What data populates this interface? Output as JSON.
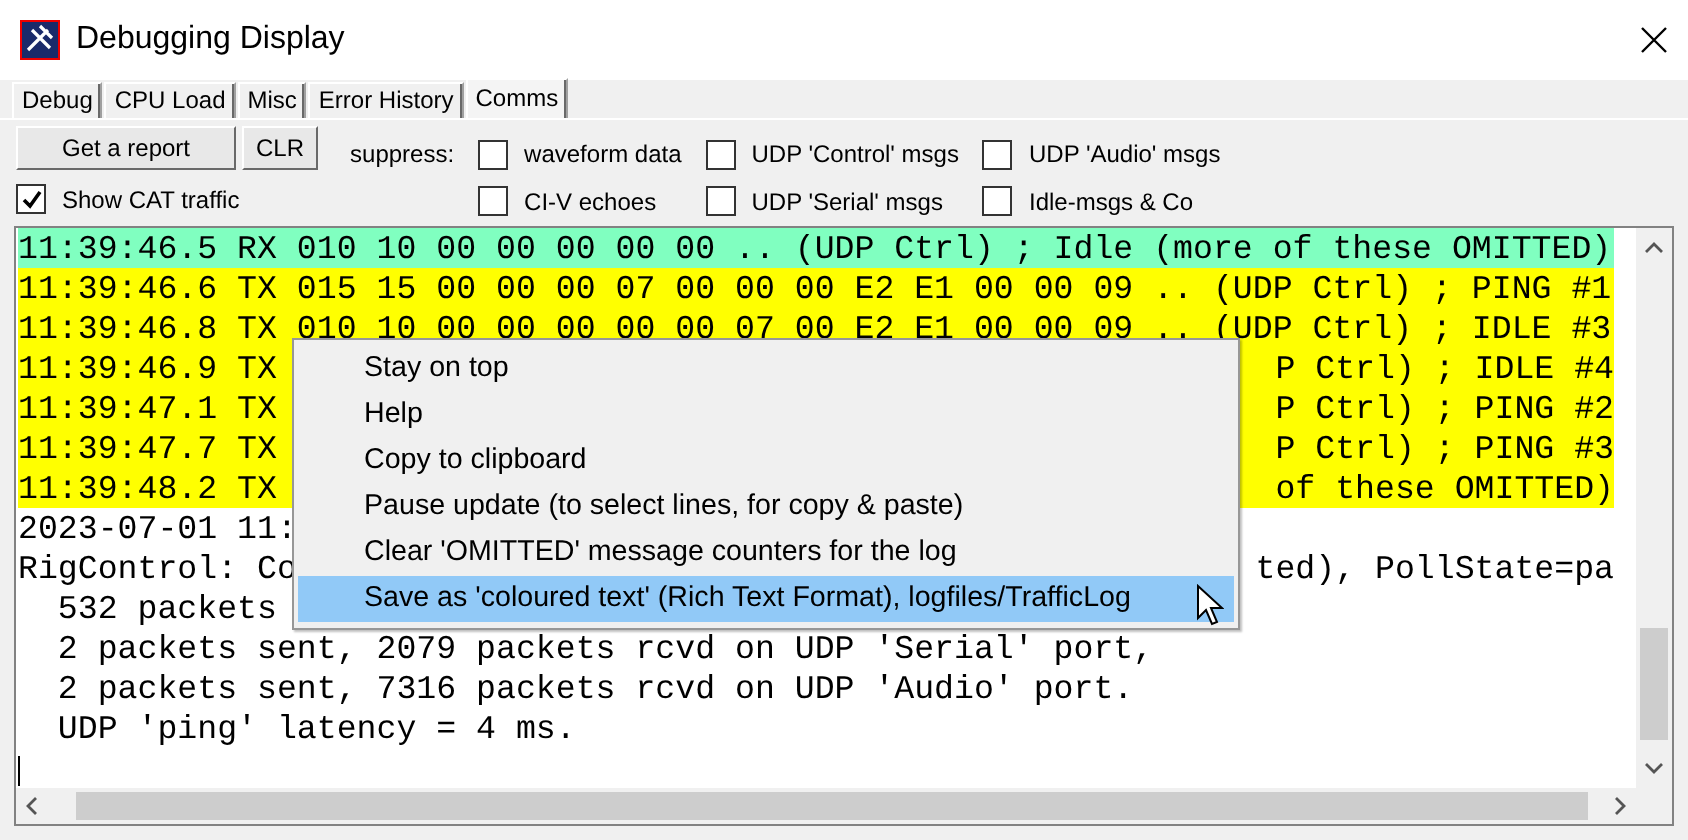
{
  "window": {
    "title": "Debugging Display"
  },
  "tabs": [
    {
      "label": "Debug",
      "selected": false
    },
    {
      "label": "CPU Load",
      "selected": false
    },
    {
      "label": "Misc",
      "selected": false
    },
    {
      "label": "Error History",
      "selected": false
    },
    {
      "label": "Comms",
      "selected": true
    }
  ],
  "buttons": [
    {
      "label": "Get a report"
    },
    {
      "label": "CLR"
    }
  ],
  "show_cat_traffic": {
    "label": "Show CAT traffic",
    "checked": true
  },
  "suppress": {
    "label": "suppress:",
    "options": [
      {
        "label": "waveform data",
        "checked": false
      },
      {
        "label": "UDP 'Control' msgs",
        "checked": false
      },
      {
        "label": "UDP 'Audio' msgs",
        "checked": false
      },
      {
        "label": "CI-V echoes",
        "checked": false
      },
      {
        "label": "UDP 'Serial' msgs",
        "checked": false
      },
      {
        "label": "Idle-msgs & Co",
        "checked": false
      }
    ]
  },
  "log": [
    {
      "text": "11:39:46.5 RX 010 10 00 00 00 00 00 .. (UDP Ctrl) ; Idle (more of these OMITTED)",
      "color": "#80ffc0"
    },
    {
      "text": "11:39:46.6 TX 015 15 00 00 00 07 00 00 00 E2 E1 00 00 09 .. (UDP Ctrl) ; PING #1",
      "color": "#ffff00"
    },
    {
      "text": "11:39:46.8 TX 010 10 00 00 00 00 00 07 00 E2 E1 00 00 09 .. (UDP Ctrl) ; IDLE #3",
      "color": "#ffff00"
    },
    {
      "text": "11:39:46.9 TX",
      "tail": "P Ctrl) ; IDLE #4",
      "color": "#ffff00"
    },
    {
      "text": "11:39:47.1 TX",
      "tail": "P Ctrl) ; PING #2",
      "color": "#ffff00"
    },
    {
      "text": "11:39:47.7 TX",
      "tail": "P Ctrl) ; PING #3",
      "color": "#ffff00"
    },
    {
      "text": "11:39:48.2 TX",
      "tail": "of these OMITTED)",
      "color": "#ffff00"
    },
    {
      "text": "2023-07-01 11:"
    },
    {
      "text": "RigControl: Co",
      "tail": "ted), PollState=pa"
    },
    {
      "text": "  532 packets"
    },
    {
      "text": "  2 packets sent, 2079 packets rcvd on UDP 'Serial' port,"
    },
    {
      "text": "  2 packets sent, 7316 packets rcvd on UDP 'Audio' port."
    },
    {
      "text": "  UDP 'ping' latency = 4 ms."
    }
  ],
  "context_menu": {
    "items": [
      {
        "label": "Stay on top",
        "selected": false
      },
      {
        "label": "Help",
        "selected": false
      },
      {
        "label": "Copy to clipboard",
        "selected": false
      },
      {
        "label": "Pause update (to select lines, for copy & paste)",
        "selected": false
      },
      {
        "label": "Clear 'OMITTED' message counters for the log",
        "selected": false
      },
      {
        "label": "Save as 'coloured text' (Rich Text Format), logfiles/TrafficLog",
        "selected": true
      }
    ]
  }
}
